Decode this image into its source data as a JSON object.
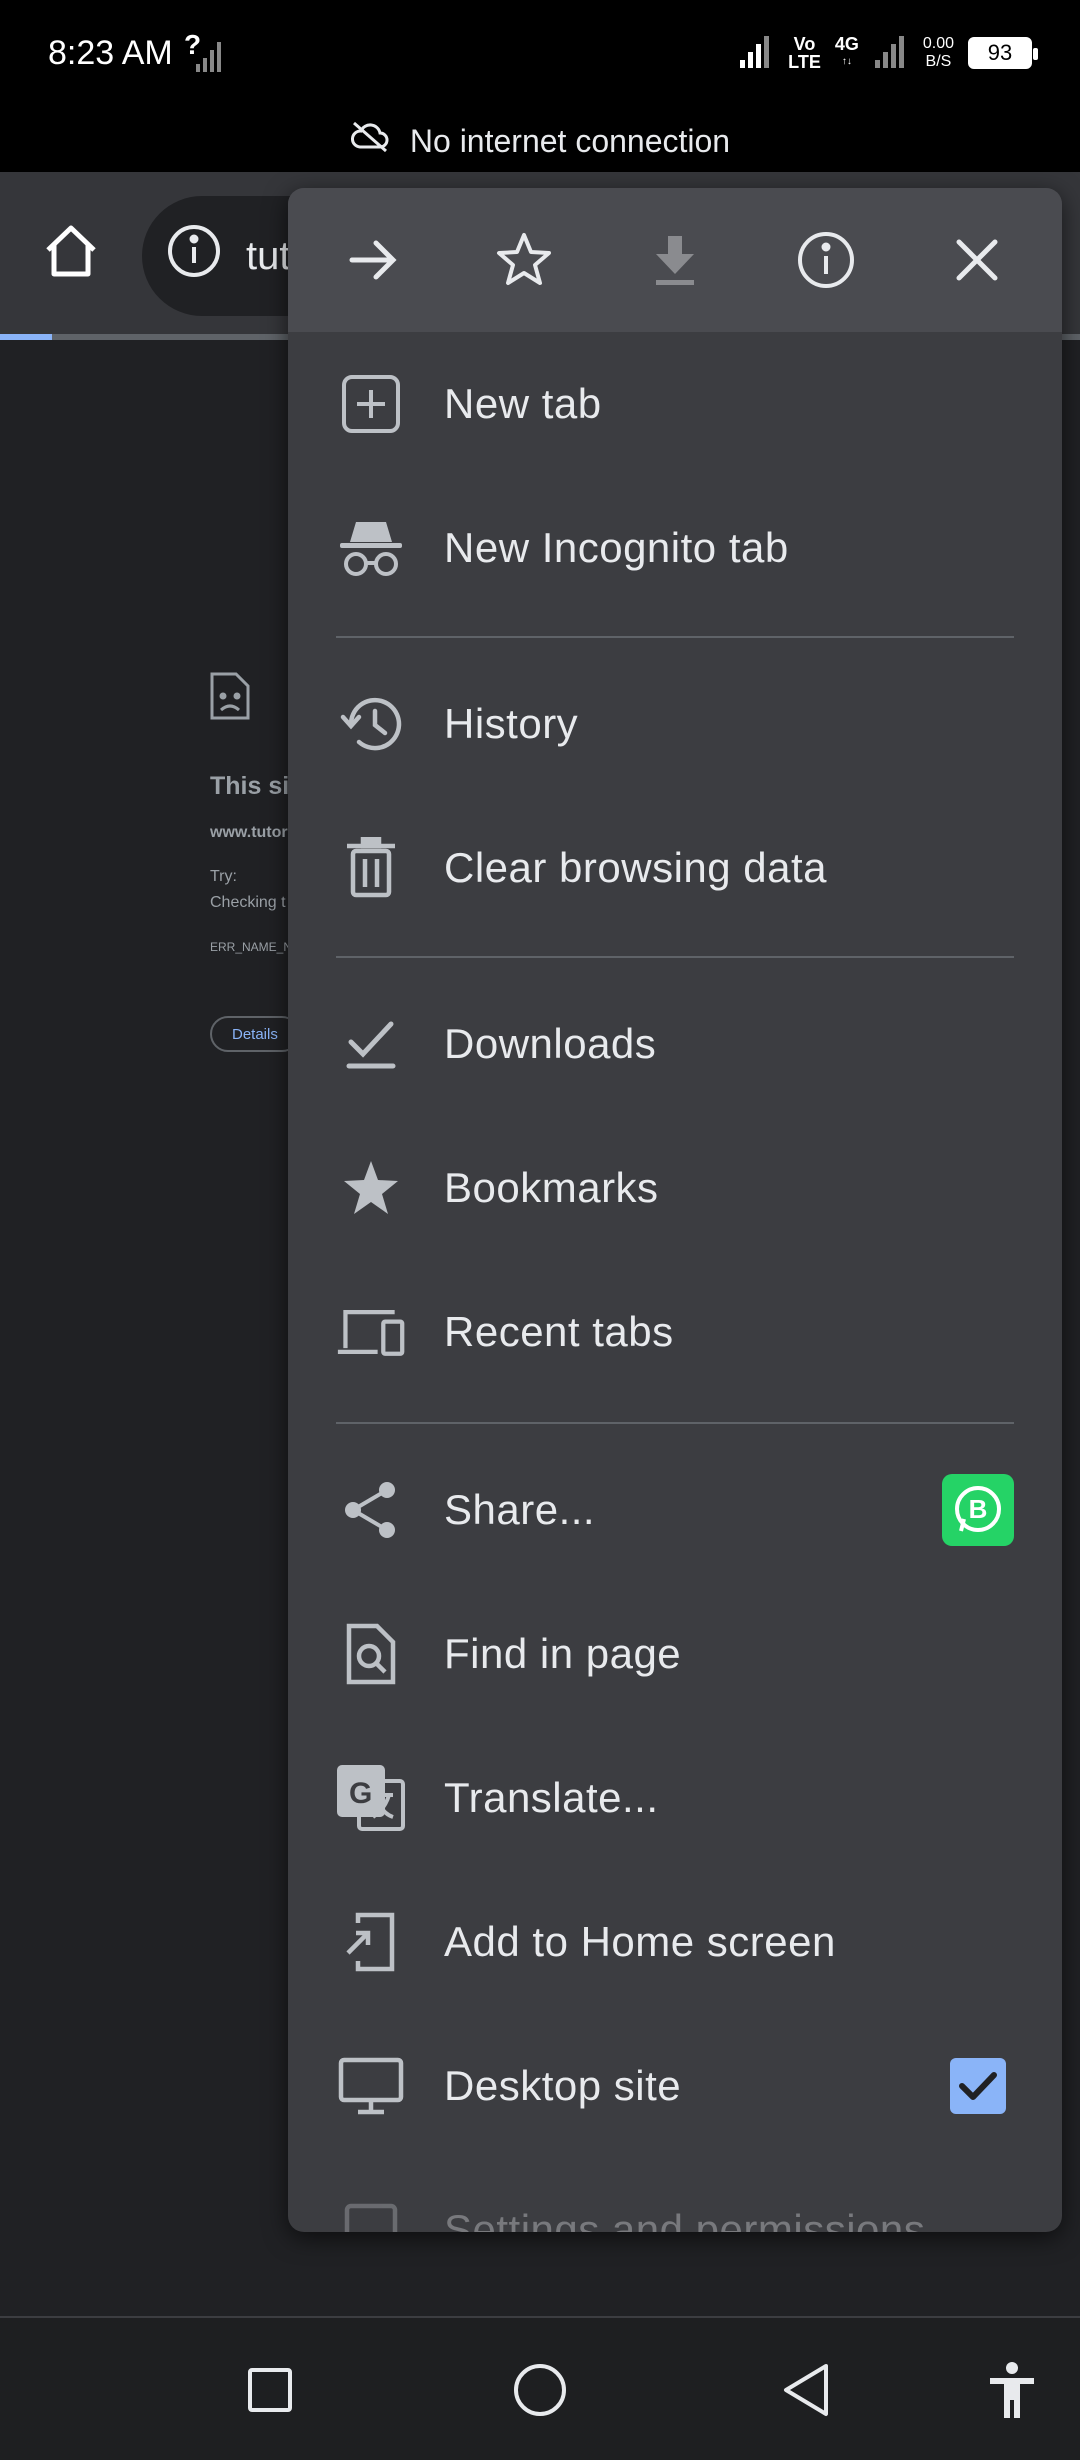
{
  "status_bar": {
    "time": "8:23 AM",
    "volte_top": "Vo",
    "volte_bottom": "LTE",
    "network": "4G",
    "speed_top": "0.00",
    "speed_bottom": "B/S",
    "battery": "93"
  },
  "offline_bar": {
    "text": "No internet connection"
  },
  "omnibox": {
    "url_fragment": "tut"
  },
  "error_page": {
    "title": "This si",
    "url": "www.tutori",
    "try_label": "Try:",
    "checking": "Checking t",
    "code": "ERR_NAME_N",
    "details_label": "Details"
  },
  "menu": {
    "items": [
      {
        "label": "New tab",
        "icon": "plus-box-icon"
      },
      {
        "label": "New Incognito tab",
        "icon": "incognito-icon"
      },
      {
        "label": "History",
        "icon": "history-icon"
      },
      {
        "label": "Clear browsing data",
        "icon": "trash-icon"
      },
      {
        "label": "Downloads",
        "icon": "download-check-icon"
      },
      {
        "label": "Bookmarks",
        "icon": "star-filled-icon"
      },
      {
        "label": "Recent tabs",
        "icon": "devices-icon"
      },
      {
        "label": "Share...",
        "icon": "share-icon"
      },
      {
        "label": "Find in page",
        "icon": "find-in-page-icon"
      },
      {
        "label": "Translate...",
        "icon": "translate-icon"
      },
      {
        "label": "Add to Home screen",
        "icon": "add-to-home-icon"
      },
      {
        "label": "Desktop site",
        "icon": "monitor-icon"
      },
      {
        "label": "Settings and permissions",
        "icon": "settings-icon"
      }
    ],
    "share_badge": "B"
  },
  "colors": {
    "menu_bg": "#3c3d41",
    "menu_header_bg": "#4a4b50",
    "accent": "#8ab4f8",
    "whatsapp_green": "#25d366"
  }
}
